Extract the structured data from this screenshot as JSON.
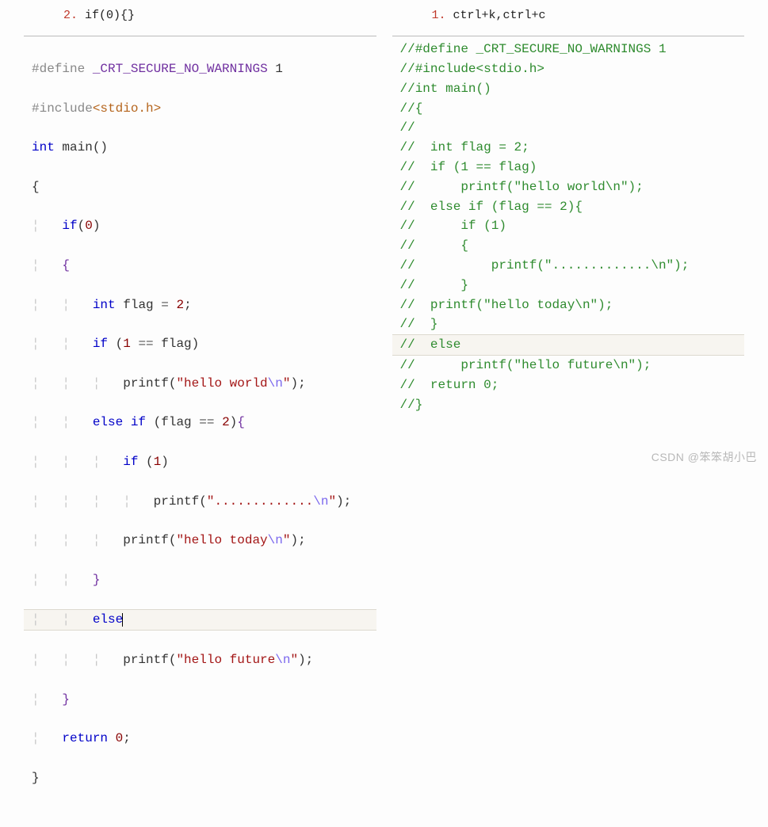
{
  "left": {
    "header_num": "2.",
    "header_text": "if(0){}",
    "code": {
      "pp_define_kw": "#define",
      "pp_define_macro": "_CRT_SECURE_NO_WARNINGS",
      "pp_define_val": "1",
      "pp_include_kw": "#include",
      "pp_include_hdr": "<stdio.h>",
      "kw_int": "int",
      "fn_main": "main",
      "kw_if": "if",
      "zero": "0",
      "var_int": "int",
      "var_name": "flag",
      "eq": "=",
      "two": "2",
      "one": "1",
      "eqeq": "==",
      "fn_printf": "printf",
      "str_world_a": "\"hello world",
      "esc_n": "\\n",
      "str_close": "\"",
      "kw_else": "else",
      "kw_if2": "if",
      "var_flag2": "flag",
      "two2": "2",
      "one2": "1",
      "str_dots": "\".............",
      "str_today": "\"hello today",
      "str_future": "\"hello future",
      "kw_return": "return",
      "zero2": "0"
    }
  },
  "right": {
    "header_num": "1.",
    "header_text": "ctrl+k,ctrl+c",
    "lines": [
      "//#define _CRT_SECURE_NO_WARNINGS 1",
      "//#include<stdio.h>",
      "//int main()",
      "//{",
      "//",
      "//  int flag = 2;",
      "//  if (1 == flag)",
      "//      printf(\"hello world\\n\");",
      "//  else if (flag == 2){",
      "//      if (1)",
      "//      {",
      "//          printf(\".............\\n\");",
      "//      }",
      "//  printf(\"hello today\\n\");",
      "//  }",
      "//  else",
      "//      printf(\"hello future\\n\");",
      "//  return 0;",
      "//}"
    ]
  },
  "watermark": "CSDN @笨笨胡小巴"
}
